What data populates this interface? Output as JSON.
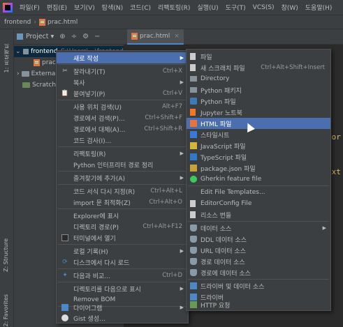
{
  "menubar": {
    "items": [
      "파일(F)",
      "편집(E)",
      "보기(V)",
      "탐색(N)",
      "코드(C)",
      "리팩토링(R)",
      "실행(U)",
      "도구(T)",
      "VCS(S)",
      "창(W)",
      "도움말(H)"
    ]
  },
  "breadcrumb": {
    "project": "frontend",
    "file": "prac.html"
  },
  "project_toolbar": {
    "label": "Project ▾"
  },
  "editor_tab": {
    "label": "prac.html"
  },
  "tree": {
    "root": "frontend",
    "root_path": "C:\\Users\\...\\frontend",
    "file": "prac.html",
    "external": "External Libraries",
    "scratches": "Scratches and Consoles"
  },
  "left_tabs": {
    "project": "1: 프로젝트",
    "structure": "Z: Structure",
    "favorites": "2: Favorites"
  },
  "code": {
    "frag1": "=",
    "frag2": ":",
    "frag3": "cor",
    "frag4": "ext"
  },
  "context_menu": {
    "items": [
      {
        "label": "새로 작성",
        "shortcut": "",
        "submenu": true,
        "icon": ""
      },
      {
        "label": "잘라내기(T)",
        "shortcut": "Ctrl+X",
        "icon": "cut-icon"
      },
      {
        "label": "복사",
        "shortcut": "",
        "submenu": true,
        "icon": ""
      },
      {
        "label": "붙여넣기(P)",
        "shortcut": "Ctrl+V",
        "icon": "paste-icon"
      },
      {
        "label": "사용 위치 검색(U)",
        "shortcut": "Alt+F7",
        "icon": ""
      },
      {
        "label": "경로에서 검색(P)...",
        "shortcut": "Ctrl+Shift+F",
        "icon": ""
      },
      {
        "label": "경로에서 대체(A)...",
        "shortcut": "Ctrl+Shift+R",
        "icon": ""
      },
      {
        "label": "코드 검사(I)...",
        "shortcut": "",
        "icon": ""
      },
      {
        "label": "리팩토링(R)",
        "shortcut": "",
        "submenu": true,
        "icon": ""
      },
      {
        "label": "Python 인터프리터 경로 정리",
        "shortcut": "",
        "icon": ""
      },
      {
        "label": "즐겨찾기에 추가(A)",
        "shortcut": "",
        "submenu": true,
        "icon": ""
      },
      {
        "label": "코드 서식 다시 지정(R)",
        "shortcut": "Ctrl+Alt+L",
        "icon": ""
      },
      {
        "label": "import 문 최적화(Z)",
        "shortcut": "Ctrl+Alt+O",
        "icon": ""
      },
      {
        "label": "Explorer에 표시",
        "shortcut": "",
        "icon": ""
      },
      {
        "label": "디렉토리 경로(P)",
        "shortcut": "Ctrl+Alt+F12",
        "icon": ""
      },
      {
        "label": "터미널에서 열기",
        "shortcut": "",
        "icon": "terminal-icon"
      },
      {
        "label": "로컬 기록(H)",
        "shortcut": "",
        "submenu": true,
        "icon": ""
      },
      {
        "label": "디스크에서 다시 로드",
        "shortcut": "",
        "icon": "reload-icon"
      },
      {
        "label": "다음과 비교...",
        "shortcut": "Ctrl+D",
        "icon": "compare-icon"
      },
      {
        "label": "디렉토리를 다음으로 표시",
        "shortcut": "",
        "submenu": true,
        "icon": ""
      },
      {
        "label": "Remove BOM",
        "shortcut": "",
        "icon": ""
      },
      {
        "label": "다이어그램",
        "shortcut": "",
        "submenu": true,
        "icon": "diagram-icon"
      },
      {
        "label": "Gist 생성...",
        "shortcut": "",
        "icon": "github-icon"
      }
    ]
  },
  "submenu": {
    "items": [
      {
        "label": "파일",
        "shortcut": "",
        "icon": "file"
      },
      {
        "label": "새 스크래치 파일",
        "shortcut": "Ctrl+Alt+Shift+Insert",
        "icon": "file"
      },
      {
        "label": "Directory",
        "shortcut": "",
        "icon": "folder"
      },
      {
        "label": "Python 패키지",
        "shortcut": "",
        "icon": "folder"
      },
      {
        "label": "Python 파일",
        "shortcut": "",
        "icon": "py"
      },
      {
        "label": "Jupyter 노트북",
        "shortcut": "",
        "icon": "file"
      },
      {
        "label": "HTML 파일",
        "shortcut": "",
        "icon": "html"
      },
      {
        "label": "스타일시트",
        "shortcut": "",
        "icon": "css"
      },
      {
        "label": "JavaScript 파일",
        "shortcut": "",
        "icon": "js"
      },
      {
        "label": "TypeScript 파일",
        "shortcut": "",
        "icon": "ts"
      },
      {
        "label": "package.json 파일",
        "shortcut": "",
        "icon": "json"
      },
      {
        "label": "Gherkin feature file",
        "shortcut": "",
        "icon": "cuke"
      },
      {
        "label": "Edit File Templates...",
        "shortcut": "",
        "icon": ""
      },
      {
        "label": "EditorConfig File",
        "shortcut": "",
        "icon": "file"
      },
      {
        "label": "리소스 번들",
        "shortcut": "",
        "icon": "file"
      },
      {
        "label": "데이터 소스",
        "shortcut": "",
        "icon": "db",
        "submenu": true
      },
      {
        "label": "DDL 데이터 소스",
        "shortcut": "",
        "icon": "db"
      },
      {
        "label": "URL 데이터 소스",
        "shortcut": "",
        "icon": "db"
      },
      {
        "label": "경로 데이터 소스",
        "shortcut": "",
        "icon": "db"
      },
      {
        "label": "경로에 데이터 소스",
        "shortcut": "",
        "icon": "db"
      },
      {
        "label": "드라이버 및 데이터 소스",
        "shortcut": "",
        "icon": "ext"
      },
      {
        "label": "드라이버",
        "shortcut": "",
        "icon": "ext"
      },
      {
        "label": "HTTP 요청",
        "shortcut": "",
        "icon": "http"
      }
    ]
  }
}
